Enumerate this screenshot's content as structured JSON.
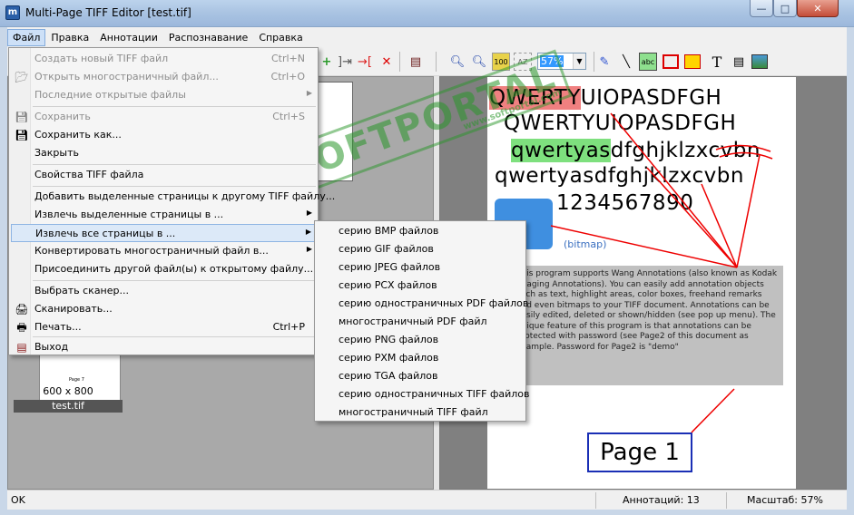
{
  "window": {
    "title": "Multi-Page TIFF Editor [test.tif]",
    "min": "—",
    "max": "□",
    "close": "✕"
  },
  "menubar": [
    {
      "label": "Файл"
    },
    {
      "label": "Правка"
    },
    {
      "label": "Аннотации"
    },
    {
      "label": "Распознавание"
    },
    {
      "label": "Справка"
    }
  ],
  "toolbar": {
    "zoom_value": "57%"
  },
  "file_menu": {
    "new": {
      "label": "Создать новый TIFF файл",
      "shortcut": "Ctrl+N"
    },
    "open": {
      "label": "Открыть многостраничный файл...",
      "shortcut": "Ctrl+O"
    },
    "recent": {
      "label": "Последние открытые файлы"
    },
    "save": {
      "label": "Сохранить",
      "shortcut": "Ctrl+S"
    },
    "save_as": {
      "label": "Сохранить как..."
    },
    "close": {
      "label": "Закрыть"
    },
    "properties": {
      "label": "Свойства TIFF файла"
    },
    "add_pages": {
      "label": "Добавить выделенные страницы к другому TIFF файлу..."
    },
    "extract_selected": {
      "label": "Извлечь выделенные страницы в ..."
    },
    "extract_all": {
      "label": "Извлечь все страницы в ..."
    },
    "convert": {
      "label": "Конвертировать многостраничный файл в..."
    },
    "attach": {
      "label": "Присоединить другой файл(ы) к открытому файлу..."
    },
    "scanner": {
      "label": "Выбрать сканер..."
    },
    "scan": {
      "label": "Сканировать..."
    },
    "print": {
      "label": "Печать...",
      "shortcut": "Ctrl+P"
    },
    "exit": {
      "label": "Выход"
    }
  },
  "submenu": [
    {
      "label": "серию BMP файлов"
    },
    {
      "label": "серию GIF файлов"
    },
    {
      "label": "серию JPEG файлов"
    },
    {
      "label": "серию PCX файлов"
    },
    {
      "label": "серию одностраничных PDF файлов"
    },
    {
      "label": "многостраничный PDF файл"
    },
    {
      "label": "серию PNG файлов"
    },
    {
      "label": "серию PXM файлов"
    },
    {
      "label": "серию TGA файлов"
    },
    {
      "label": "серию одностраничных TIFF файлов"
    },
    {
      "label": "многостраничный TIFF файл"
    }
  ],
  "thumbnail": {
    "page_label": "Page 7",
    "size": "600 x 800",
    "file": "test.tif"
  },
  "document": {
    "row1_hl": "QWERTY",
    "row1_rest": "UIOPASDFGH",
    "row2": "QWERTYUIOPASDFGH",
    "row3_hl": "qwertyas",
    "row3_rest": "dfghjklzxcvbn",
    "row4": "qwertyasdfghjklzxcvbn",
    "row5": "1234567890",
    "bitmap_label": "(bitmap)",
    "note": "This program supports Wang Annotations (also known as Kodak Imaging Annotations). You can easily add annotation objects such as text, highlight areas, color boxes, freehand remarks and even bitmaps to your TIFF document. Annotations can be easily edited, deleted or shown/hidden (see pop up menu). The unique feature of this program is that annotations can be protected with password (see Page2 of this document as example. Password for Page2 is \"demo\"",
    "page_label": "Page 1"
  },
  "watermark": {
    "text": "SOFTPORTAL",
    "url": "www.softportal.com"
  },
  "status": {
    "left": "OK",
    "annotations": "Аннотаций: 13",
    "zoom": "Масштаб: 57%"
  }
}
